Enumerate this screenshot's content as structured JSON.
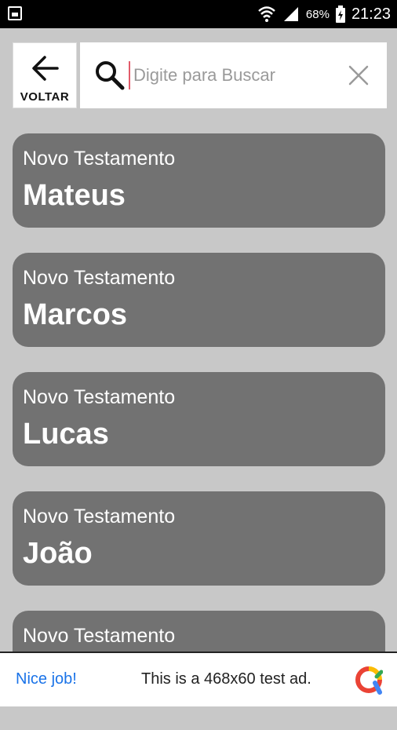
{
  "status_bar": {
    "battery": "68%",
    "time": "21:23",
    "icons": [
      "notification-icon",
      "wifi-icon",
      "signal-icon",
      "battery-icon"
    ]
  },
  "header": {
    "back_label": "VOLTAR",
    "search": {
      "placeholder": "Digite para Buscar",
      "value": ""
    }
  },
  "books": [
    {
      "testament": "Novo Testamento",
      "name": "Mateus"
    },
    {
      "testament": "Novo Testamento",
      "name": "Marcos"
    },
    {
      "testament": "Novo Testamento",
      "name": "Lucas"
    },
    {
      "testament": "Novo Testamento",
      "name": "João"
    },
    {
      "testament": "Novo Testamento",
      "name": ""
    }
  ],
  "ad": {
    "cta": "Nice job!",
    "text": "This is a 468x60 test ad."
  },
  "colors": {
    "background": "#c8c8c8",
    "card": "#727272",
    "link": "#1a73e8",
    "cursor": "#e25b6a"
  }
}
